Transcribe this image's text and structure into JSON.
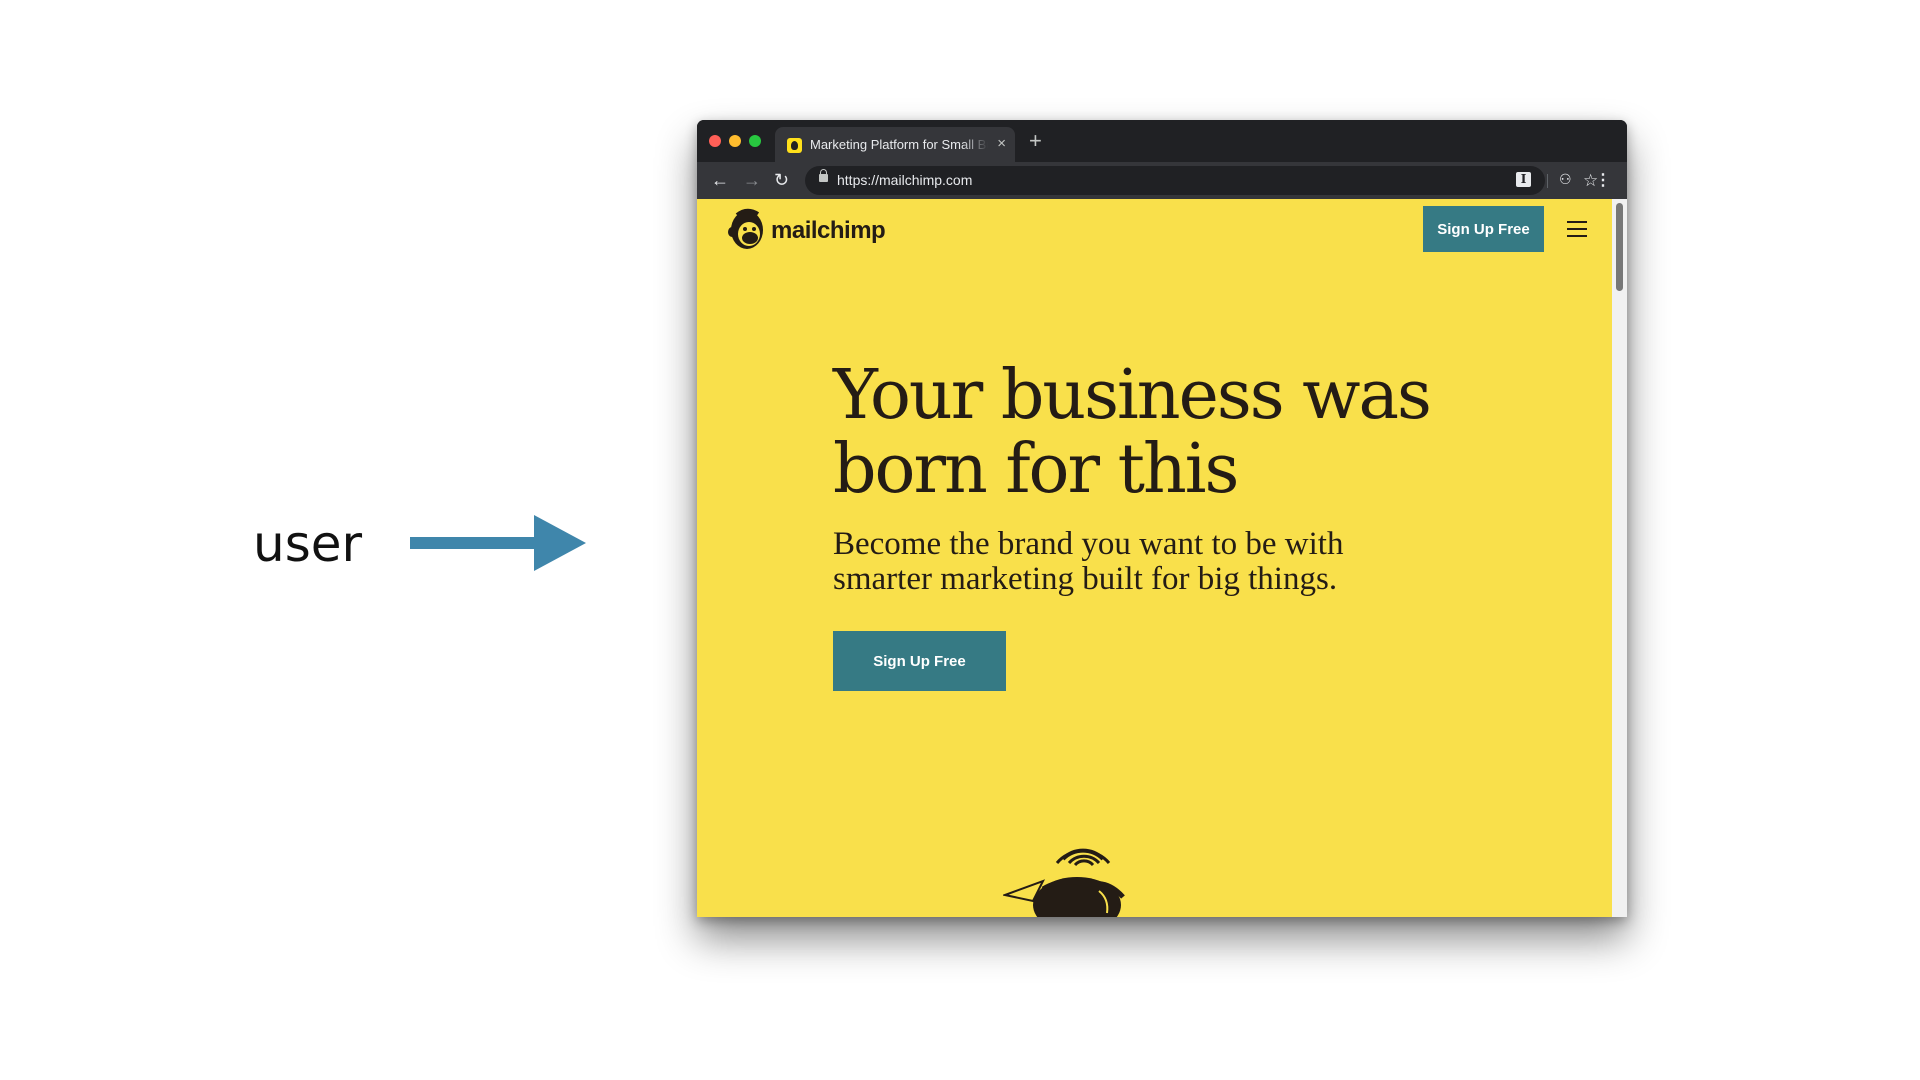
{
  "slide": {
    "label": "user"
  },
  "browser": {
    "tab": {
      "title": "Marketing Platform for Small Business",
      "close": "×"
    },
    "new_tab": "+",
    "toolbar": {
      "back": "←",
      "forward": "→",
      "reload": "↻",
      "url": "https://mailchimp.com",
      "star": "☆",
      "extension": "I",
      "incognito": "⚇",
      "menu": "⋮"
    }
  },
  "page": {
    "brand": "mailchimp",
    "header_cta": "Sign Up Free",
    "hero": {
      "title": "Your business was born for this",
      "subtitle": "Become the brand you want to be with smarter marketing built for big things.",
      "cta": "Sign Up Free"
    }
  },
  "colors": {
    "page_background": "#f9e04b",
    "cta_background": "#367a84",
    "arrow": "#3f86ab",
    "text": "#241c15"
  },
  "icons": [
    "arrow-right-icon",
    "back-arrow-icon",
    "forward-arrow-icon",
    "reload-icon",
    "lock-icon",
    "star-icon",
    "extension-icon",
    "incognito-icon",
    "kebab-menu-icon",
    "hamburger-menu-icon",
    "mailchimp-logo-icon"
  ]
}
